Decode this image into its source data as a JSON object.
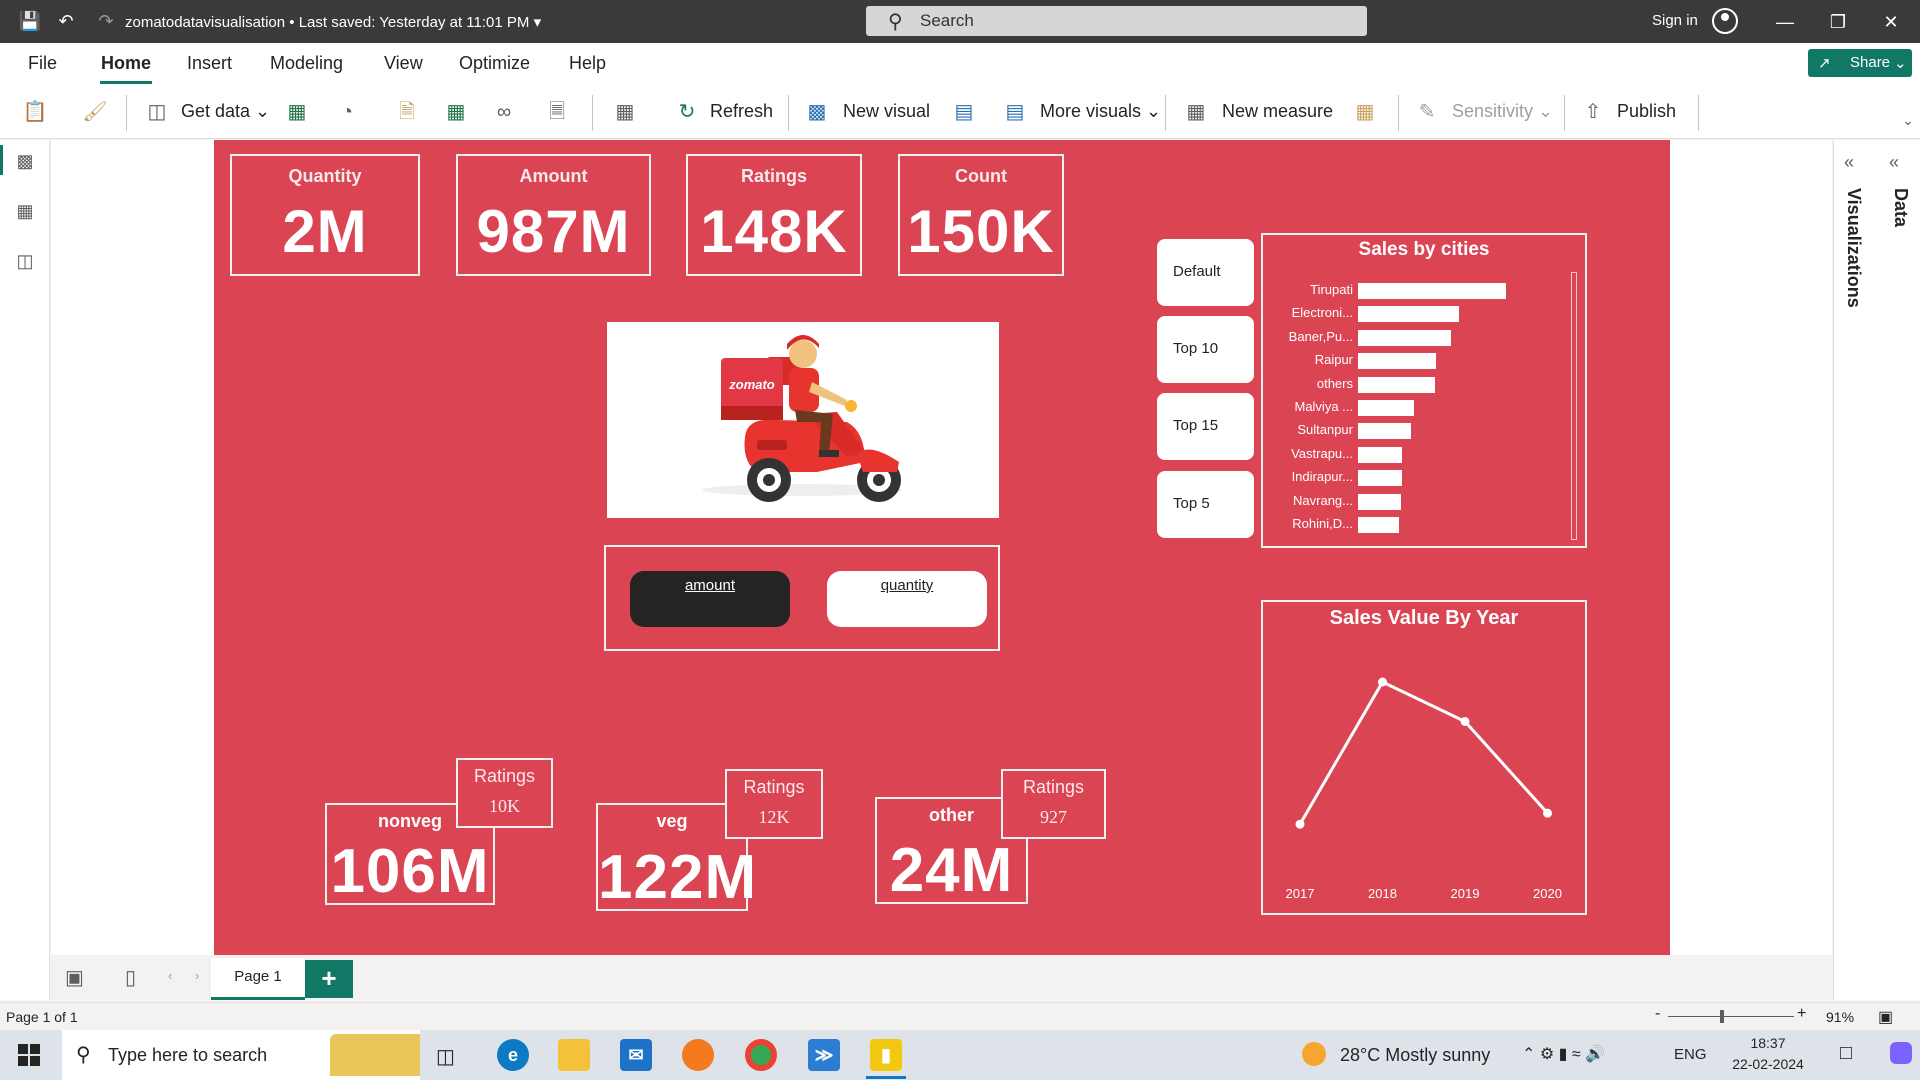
{
  "titlebar": {
    "file_name": "zomatodatavisualisation",
    "saved_status": "Last saved: Yesterday at 11:01 PM",
    "search_placeholder": "Search",
    "sign_in": "Sign in"
  },
  "menu": {
    "tabs": [
      "File",
      "Home",
      "Insert",
      "Modeling",
      "View",
      "Optimize",
      "Help"
    ],
    "active": "Home",
    "share": "Share"
  },
  "ribbon": {
    "get_data": "Get data",
    "refresh": "Refresh",
    "new_visual": "New visual",
    "more_visuals": "More visuals",
    "new_measure": "New measure",
    "sensitivity": "Sensitivity",
    "publish": "Publish"
  },
  "right_panes": {
    "visualizations": "Visualizations",
    "data": "Data"
  },
  "kpis": [
    {
      "title": "Quantity",
      "value": "2M"
    },
    {
      "title": "Amount",
      "value": "987M"
    },
    {
      "title": "Ratings",
      "value": "148K"
    },
    {
      "title": "Count",
      "value": "150K"
    }
  ],
  "logo_text": "zomato",
  "toggle": {
    "amount": "amount",
    "quantity": "quantity"
  },
  "slicers": [
    "Default",
    "Top 10",
    "Top 15",
    "Top 5"
  ],
  "sales_by_cities": {
    "title": "Sales by cities",
    "cities": [
      "Tirupati",
      "Electroni...",
      "Baner,Pu...",
      "Raipur",
      "others",
      "Malviya ...",
      "Sultanpur",
      "Vastrapu...",
      "Indirapur...",
      "Navrang...",
      "Rohini,D..."
    ],
    "values": [
      100,
      68,
      63,
      53,
      52,
      38,
      36,
      30,
      30,
      29,
      28
    ]
  },
  "chart_data": {
    "type": "line",
    "title": "Sales Value By Year",
    "x": [
      "2017",
      "2018",
      "2019",
      "2020"
    ],
    "series": [
      {
        "values": [
          0.1,
          1.0,
          0.75,
          0.17
        ]
      }
    ],
    "grid": false
  },
  "food_types": [
    {
      "name": "nonveg",
      "value": "106M",
      "ratings_label": "Ratings",
      "ratings": "10K"
    },
    {
      "name": "veg",
      "value": "122M",
      "ratings_label": "Ratings",
      "ratings": "12K"
    },
    {
      "name": "other",
      "value": "24M",
      "ratings_label": "Ratings",
      "ratings": "927"
    }
  ],
  "pages": {
    "current": "Page 1",
    "status": "Page 1 of 1",
    "zoom": "91%"
  },
  "taskbar": {
    "search": "Type here to search",
    "weather": "28°C  Mostly sunny",
    "lang": "ENG",
    "time": "18:37",
    "date": "22-02-2024"
  }
}
